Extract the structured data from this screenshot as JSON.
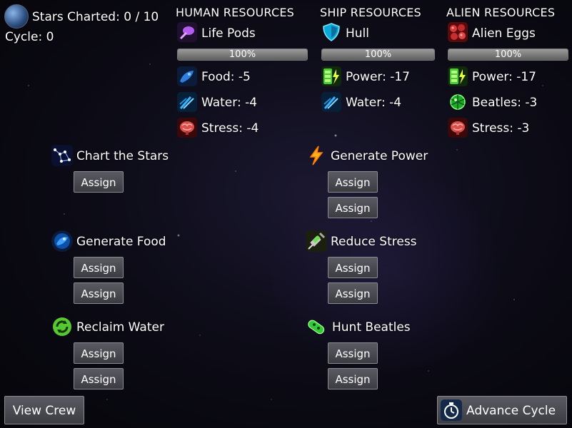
{
  "status": {
    "stars_charted": "Stars Charted: 0 / 10",
    "cycle": "Cycle: 0"
  },
  "headers": {
    "human": "HUMAN RESOURCES",
    "ship": "SHIP RESOURCES",
    "alien": "ALIEN RESOURCES"
  },
  "human": {
    "primary": "Life Pods",
    "bar_label": "100%",
    "bar_level": 1.0,
    "food": "Food: -5",
    "water": "Water: -4",
    "stress": "Stress: -4"
  },
  "ship": {
    "primary": "Hull",
    "bar_label": "100%",
    "bar_level": 1.0,
    "power": "Power: -17",
    "water": "Water: -4"
  },
  "alien": {
    "primary": "Alien Eggs",
    "bar_label": "100%",
    "bar_level": 1.0,
    "power": "Power: -17",
    "beatles": "Beatles: -3",
    "stress": "Stress: -3"
  },
  "tasks": {
    "chart_stars": "Chart the Stars",
    "generate_power": "Generate Power",
    "generate_food": "Generate Food",
    "reduce_stress": "Reduce Stress",
    "reclaim_water": "Reclaim Water",
    "hunt_beatles": "Hunt Beatles"
  },
  "assign_label": "Assign",
  "buttons": {
    "view_crew": "View Crew",
    "advance_cycle": "Advance Cycle"
  },
  "icons": {
    "stars": "planet-icon",
    "life_pods": "life-pod-icon",
    "hull": "shield-icon",
    "alien_eggs": "alien-egg-icon",
    "food": "food-icon",
    "water": "water-icon",
    "stress": "brain-icon",
    "power": "battery-icon",
    "beatles": "beatle-icon",
    "chart": "constellation-icon",
    "gen_power": "lightning-icon",
    "gen_food": "food-pod-icon",
    "reduce_stress": "syringe-icon",
    "reclaim": "recycle-icon",
    "hunt": "capsule-icon",
    "advance": "stopwatch-icon"
  }
}
